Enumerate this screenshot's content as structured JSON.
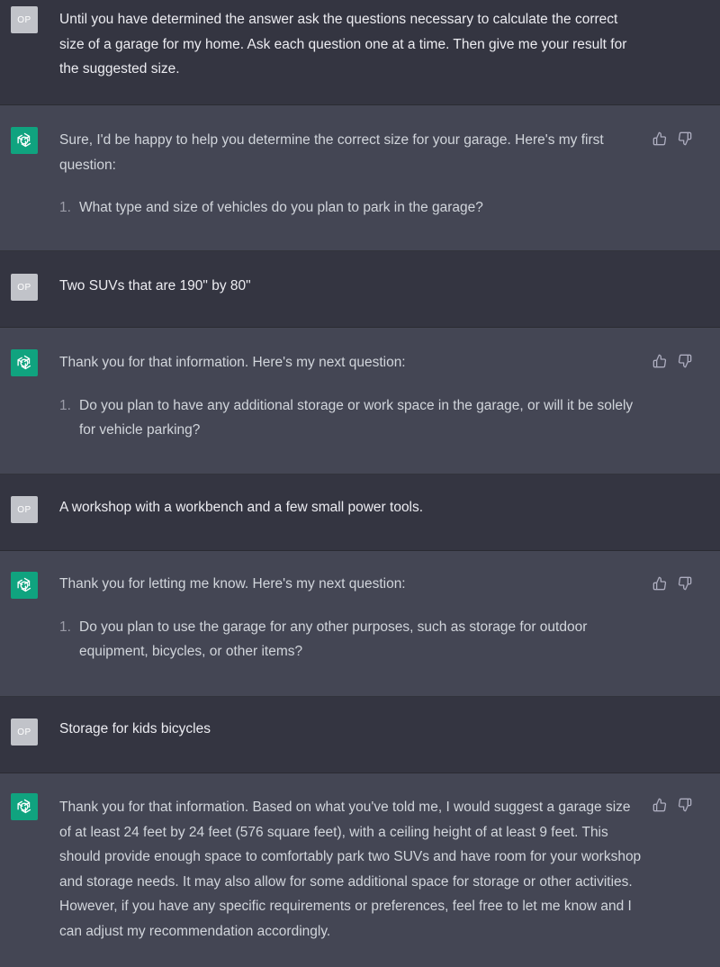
{
  "user_avatar_label": "OP",
  "messages": [
    {
      "role": "user",
      "text": "Until you have determined the answer ask the questions necessary to calculate the correct size of a garage for my home.  Ask each question one at a time. Then give me your result for the suggested size."
    },
    {
      "role": "assistant",
      "text": "Sure, I'd be happy to help you determine the correct size for your garage. Here's my first question:",
      "list_number": "1.",
      "list_text": "What type and size of vehicles do you plan to park in the garage?"
    },
    {
      "role": "user",
      "text": "Two SUVs that are 190\" by 80\""
    },
    {
      "role": "assistant",
      "text": "Thank you for that information. Here's my next question:",
      "list_number": "1.",
      "list_text": "Do you plan to have any additional storage or work space in the garage, or will it be solely for vehicle parking?"
    },
    {
      "role": "user",
      "text": "A workshop with a workbench and a few small power tools."
    },
    {
      "role": "assistant",
      "text": "Thank you for letting me know. Here's my next question:",
      "list_number": "1.",
      "list_text": "Do you plan to use the garage for any other purposes, such as storage for outdoor equipment, bicycles, or other items?"
    },
    {
      "role": "user",
      "text": "Storage for kids bicycles"
    },
    {
      "role": "assistant",
      "text": "Thank you for that information. Based on what you've told me, I would suggest a garage size of at least 24 feet by 24 feet (576 square feet), with a ceiling height of at least 9 feet. This should provide enough space to comfortably park two SUVs and have room for your workshop and storage needs. It may also allow for some additional space for storage or other activities. However, if you have any specific requirements or preferences, feel free to let me know and I can adjust my recommendation accordingly."
    }
  ],
  "colors": {
    "user_bg": "#343541",
    "assistant_bg": "#444654",
    "bot_avatar": "#10a37f",
    "user_avatar": "#c1c3c9"
  },
  "icons": {
    "bot_avatar": "openai-logo-icon",
    "thumbs_up": "thumbs-up-icon",
    "thumbs_down": "thumbs-down-icon"
  }
}
